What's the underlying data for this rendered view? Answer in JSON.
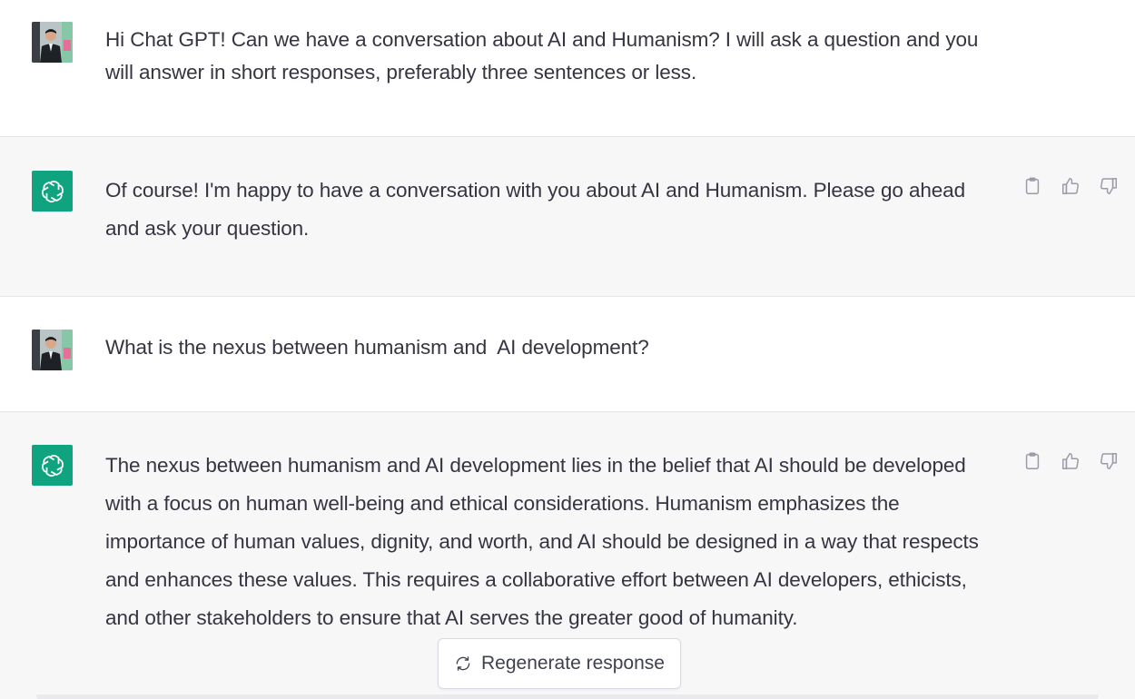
{
  "conversation": {
    "messages": [
      {
        "role": "user",
        "text": "Hi Chat GPT! Can we have a conversation about AI and Humanism? I will ask a question and you will answer in short responses, preferably three sentences or less."
      },
      {
        "role": "assistant",
        "text": "Of course! I'm happy to have a conversation with you about AI and Humanism. Please go ahead and ask your question."
      },
      {
        "role": "user",
        "text": "What is the nexus between humanism and  AI development?"
      },
      {
        "role": "assistant",
        "text": "The nexus between humanism and AI development lies in the belief that AI should be developed with a focus on human well-being and ethical considerations. Humanism emphasizes the importance of human values, dignity, and worth, and AI should be designed in a way that respects and enhances these values. This requires a collaborative effort between AI developers, ethicists, and other stakeholders to ensure that AI serves the greater good of humanity."
      }
    ]
  },
  "regenerate": {
    "label": "Regenerate response",
    "icon": "refresh-icon"
  },
  "icons": {
    "copy": "clipboard-icon",
    "like": "thumbs-up-icon",
    "dislike": "thumbs-down-icon",
    "bot_avatar": "openai-logo-icon",
    "user_avatar": "user-photo"
  },
  "colors": {
    "bot_avatar_bg": "#10a37f",
    "assistant_bg": "#f7f7f8",
    "user_bg": "#ffffff",
    "text": "#343541",
    "icon": "#9a9ba8"
  }
}
